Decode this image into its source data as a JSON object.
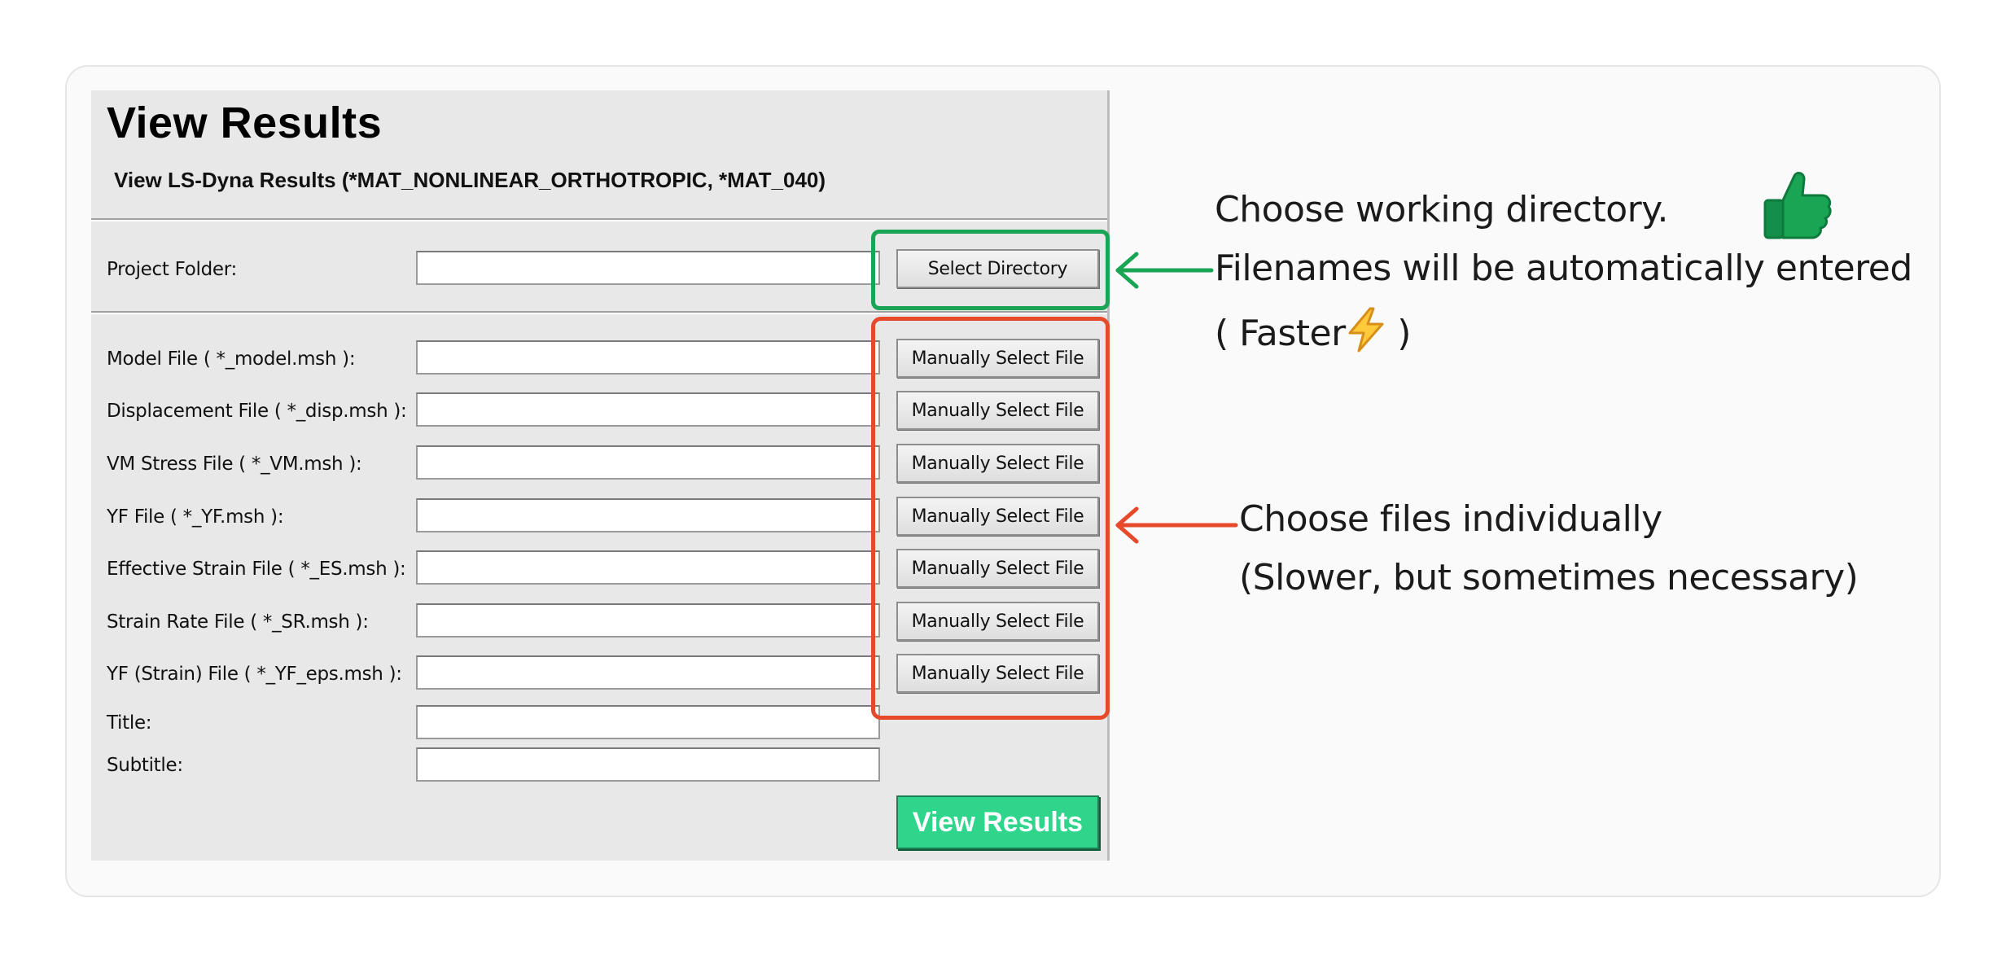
{
  "panel": {
    "title": "View Results",
    "subtitle": "View LS-Dyna Results (*MAT_NONLINEAR_ORTHOTROPIC, *MAT_040)"
  },
  "project": {
    "label": "Project Folder:",
    "value": "",
    "button": "Select Directory"
  },
  "files": [
    {
      "label": "Model File ( *_model.msh ):",
      "value": "",
      "button": "Manually Select File"
    },
    {
      "label": "Displacement File ( *_disp.msh ):",
      "value": "",
      "button": "Manually Select File"
    },
    {
      "label": "VM Stress File ( *_VM.msh ):",
      "value": "",
      "button": "Manually Select File"
    },
    {
      "label": "YF File ( *_YF.msh ):",
      "value": "",
      "button": "Manually Select File"
    },
    {
      "label": "Effective Strain File ( *_ES.msh ):",
      "value": "",
      "button": "Manually Select File"
    },
    {
      "label": "Strain Rate File ( *_SR.msh ):",
      "value": "",
      "button": "Manually Select File"
    },
    {
      "label": "YF (Strain) File ( *_YF_eps.msh ):",
      "value": "",
      "button": "Manually Select File"
    }
  ],
  "title_field": {
    "label": "Title:",
    "value": ""
  },
  "subtitle_field": {
    "label": "Subtitle:",
    "value": ""
  },
  "view_button": "View Results",
  "annotations": {
    "directory": {
      "line1": "Choose working directory.",
      "line2": "Filenames will be automatically entered",
      "line3_prefix": "( Faster",
      "line3_suffix": " )",
      "color": "#1aa555"
    },
    "individual": {
      "line1": "Choose files individually",
      "line2": "(Slower, but sometimes necessary)",
      "color": "#e64a2a"
    }
  },
  "icons": {
    "thumbs_up": "thumbs-up-icon",
    "lightning": "lightning-icon"
  }
}
